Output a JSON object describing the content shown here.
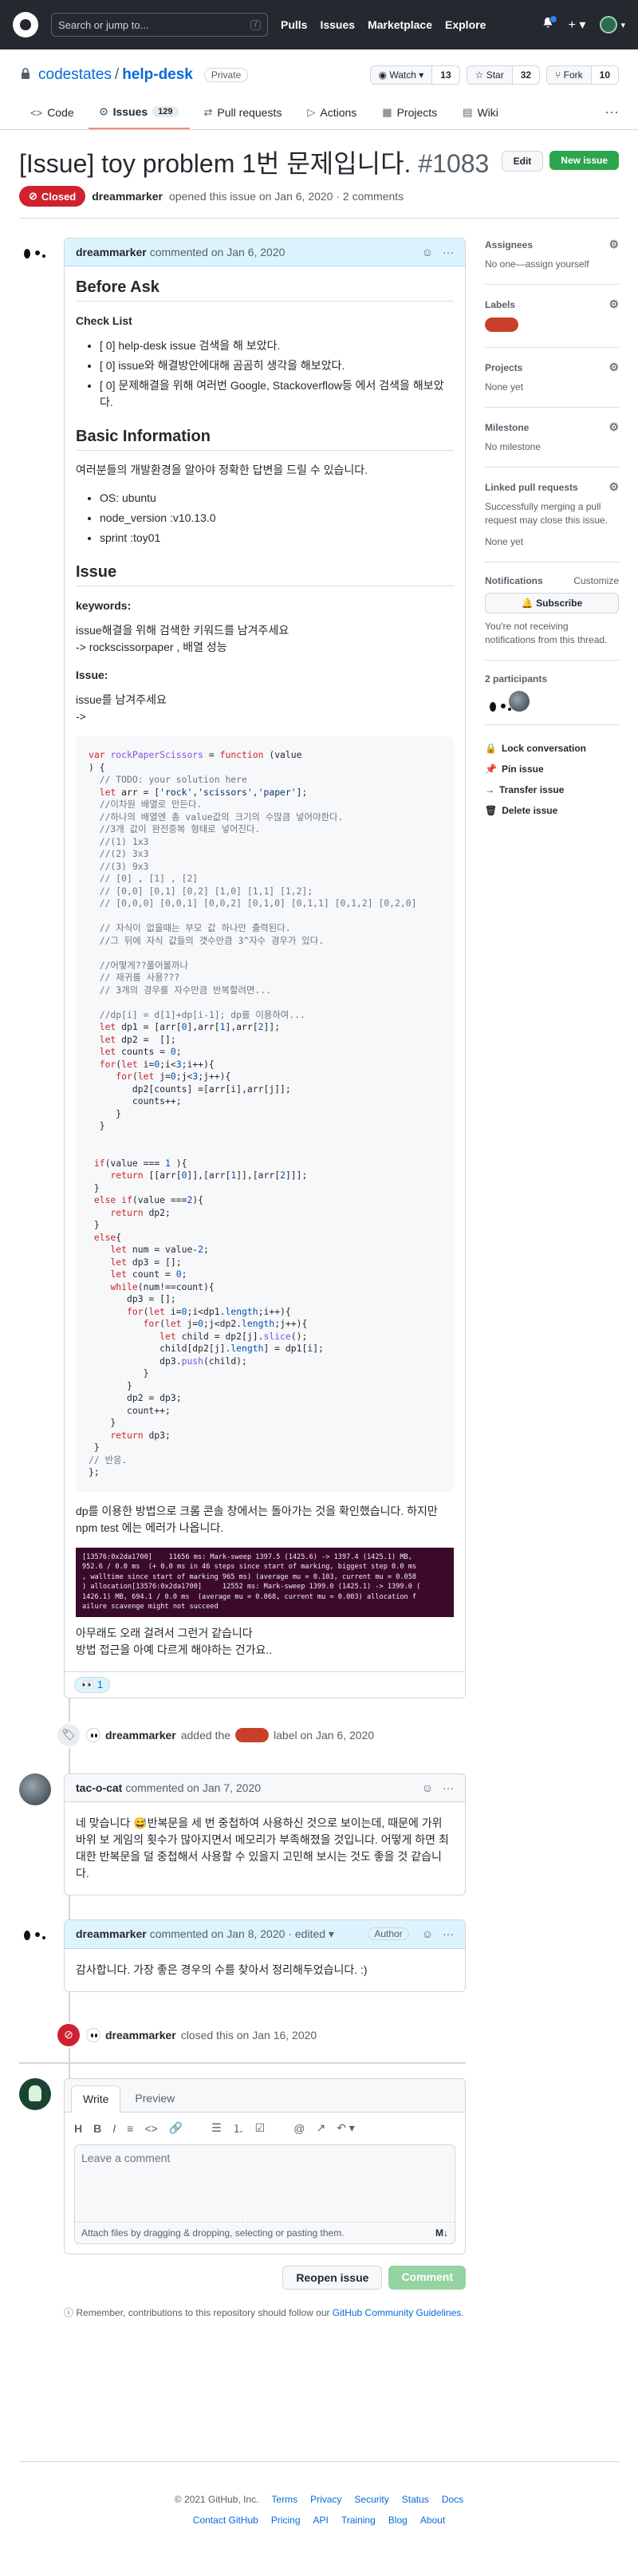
{
  "header": {
    "search_placeholder": "Search or jump to...",
    "search_key": "/",
    "nav": [
      "Pulls",
      "Issues",
      "Marketplace",
      "Explore"
    ],
    "plus": "+ ▾",
    "user_caret": "▾"
  },
  "repo": {
    "owner": "codestates",
    "sep": "/",
    "name": "help-desk",
    "visibility": "Private",
    "watch_label": "◉ Watch ▾",
    "watch_count": "13",
    "star_label": "☆ Star",
    "star_count": "32",
    "fork_label": "⑂ Fork",
    "fork_count": "10",
    "tabs": [
      {
        "icon": "<>",
        "label": "Code"
      },
      {
        "icon": "⊙",
        "label": "Issues",
        "count": "129"
      },
      {
        "icon": "⇄",
        "label": "Pull requests"
      },
      {
        "icon": "▷",
        "label": "Actions"
      },
      {
        "icon": "▦",
        "label": "Projects"
      },
      {
        "icon": "▤",
        "label": "Wiki"
      }
    ],
    "tabs_more": "···"
  },
  "issue": {
    "title": "[Issue] toy problem 1번 문제입니다.",
    "number": "#1083",
    "edit_label": "Edit",
    "new_issue_label": "New issue",
    "state": "Closed",
    "author": "dreammarker",
    "opened_text": "opened this issue on Jan 6, 2020 · 2 comments"
  },
  "first_comment": {
    "author": "dreammarker",
    "time": "commented on Jan 6, 2020",
    "before_ask": "Before Ask",
    "checklist_title": "Check List",
    "checklist": [
      "[ 0] help-desk issue 검색을 해 보았다.",
      "[ 0] issue와 해결방안에대해 곰곰히 생각을 해보았다.",
      "[ 0] 문제해결을 위해 여러번 Google, Stackoverflow등 에서 검색을 해보았다."
    ],
    "basic_info_title": "Basic Information",
    "basic_info_desc": "여러분들의 개발환경을 알아야 정확한 답변을 드릴 수 있습니다.",
    "env": [
      "OS: ubuntu",
      "node_version :v10.13.0",
      "sprint :toy01"
    ],
    "issue_title": "Issue",
    "keywords_label": "keywords:",
    "keywords_line1": "issue해결을 위해 검색한 키워드를 남겨주세요",
    "keywords_line2": "-> rockscissorpaper , 배열 성능",
    "issue_label": "Issue:",
    "issue_line1": "issue를 남겨주세요",
    "issue_line2": "->",
    "after_code_1": "dp를 이용한 방법으로 크롬 콘솔 창에서는 돌아가는 것을 확인했습니다. 하지만 npm test 에는 에러가 나옵니다.",
    "after_code_2": "아무래도 오래 걸려서 그런거 같습니다",
    "after_code_3": "방법 접근을 아예 다르게 해야하는 건가요..",
    "terminal_lines": [
      "[13576:0x2da1700]    11656 ms: Mark-sweep 1397.5 (1425.6) -> 1397.4 (1425.1) MB,",
      "952.6 / 0.0 ms  (+ 0.0 ms in 46 steps since start of marking, biggest step 0.0 ms",
      ", walltime since start of marking 965 ms) (average mu = 0.103, current mu = 0.058",
      ") allocation[13576:0x2da1700]     12552 ms: Mark-sweep 1399.0 (1425.1) -> 1399.0 (",
      "1426.1) MB, 694.1 / 0.0 ms  (average mu = 0.068, current mu = 0.003) allocation f",
      "ailure scavenge might not succeed"
    ],
    "reaction_emoji": "👀",
    "reaction_count": "1"
  },
  "events": {
    "label_actor": "dreammarker",
    "label_text1": "added the",
    "label_text2": "label on Jan 6, 2020",
    "closed_actor": "dreammarker",
    "closed_text": "closed this on Jan 16, 2020"
  },
  "cat_comment": {
    "author": "tac-o-cat",
    "time": "commented on Jan 7, 2020",
    "body": "네 맞습니다 😅반복문을 세 번 중첩하여 사용하신 것으로 보이는데, 때문에 가위 바위 보 게임의 횟수가 많아지면서 메모리가 부족해졌을 것입니다. 어떻게 하면 최대한 반복문을 덜 중첩해서 사용할 수 있을지 고민해 보시는 것도 좋을 것 같습니다."
  },
  "author_comment": {
    "author": "dreammarker",
    "time": "commented on Jan 8, 2020 · edited ▾",
    "badge": "Author",
    "body": "감사합니다. 가장 좋은 경우의 수를 찾아서 정리해두었습니다. :)"
  },
  "new_comment": {
    "write_tab": "Write",
    "preview_tab": "Preview",
    "toolbar": [
      "H",
      "B",
      "I",
      "≡",
      "<>",
      "🔗",
      "☰",
      "⒈",
      "☑",
      "@",
      "↗",
      "↶ ▾"
    ],
    "placeholder": "Leave a comment",
    "attach_text": "Attach files by dragging & dropping, selecting or pasting them.",
    "md_icon": "M↓",
    "reopen_label": "Reopen issue",
    "comment_label": "Comment",
    "remember_prefix": "Remember, contributions to this repository should follow our",
    "remember_link": "GitHub Community Guidelines",
    "remember_suffix": "."
  },
  "sidebar": {
    "assignees_title": "Assignees",
    "assignees_value": "No one—assign yourself",
    "labels_title": "Labels",
    "projects_title": "Projects",
    "projects_value": "None yet",
    "milestone_title": "Milestone",
    "milestone_value": "No milestone",
    "linked_title": "Linked pull requests",
    "linked_desc": "Successfully merging a pull request may close this issue.",
    "linked_value": "None yet",
    "notifications_title": "Notifications",
    "customize_label": "Customize",
    "subscribe_label": "🔔 Subscribe",
    "notif_desc": "You're not receiving notifications from this thread.",
    "participants_title": "2 participants",
    "lock_label": "Lock conversation",
    "pin_label": "Pin issue",
    "transfer_label": "Transfer issue",
    "delete_label": "Delete issue"
  },
  "footer": {
    "copyright": "© 2021 GitHub, Inc.",
    "row1": [
      "Terms",
      "Privacy",
      "Security",
      "Status",
      "Docs"
    ],
    "row2": [
      "Contact GitHub",
      "Pricing",
      "API",
      "Training",
      "Blog",
      "About"
    ]
  },
  "colors": {
    "closed": "#cf222e",
    "label": "#c8402a",
    "accent": "#0969da",
    "new_issue": "#2da44e"
  }
}
